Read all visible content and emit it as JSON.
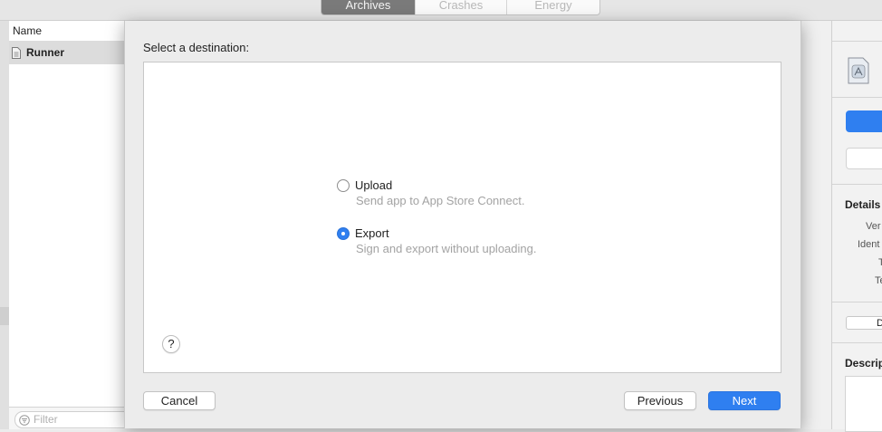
{
  "tabs": [
    {
      "label": "Archives",
      "active": true
    },
    {
      "label": "Crashes",
      "active": false
    },
    {
      "label": "Energy",
      "active": false
    }
  ],
  "archive_list": {
    "column_header": "Name",
    "items": [
      {
        "label": "Runner",
        "icon": "document-icon"
      }
    ],
    "filter_placeholder": "Filter"
  },
  "sheet": {
    "title": "Select a destination:",
    "options": [
      {
        "label": "Upload",
        "description": "Send app to App Store Connect.",
        "selected": false
      },
      {
        "label": "Export",
        "description": "Sign and export without uploading.",
        "selected": true
      }
    ],
    "help_label": "?",
    "cancel_label": "Cancel",
    "previous_label": "Previous",
    "next_label": "Next"
  },
  "inspector": {
    "details_heading": "Details",
    "meta_labels": [
      "Ver",
      "Ident",
      "T",
      "Te"
    ],
    "button_label": "D",
    "description_heading": "Descrip"
  },
  "colors": {
    "accent": "#2f7ff0",
    "active_tab": "#7a7a7a",
    "hint_text": "#a3a3a3"
  }
}
